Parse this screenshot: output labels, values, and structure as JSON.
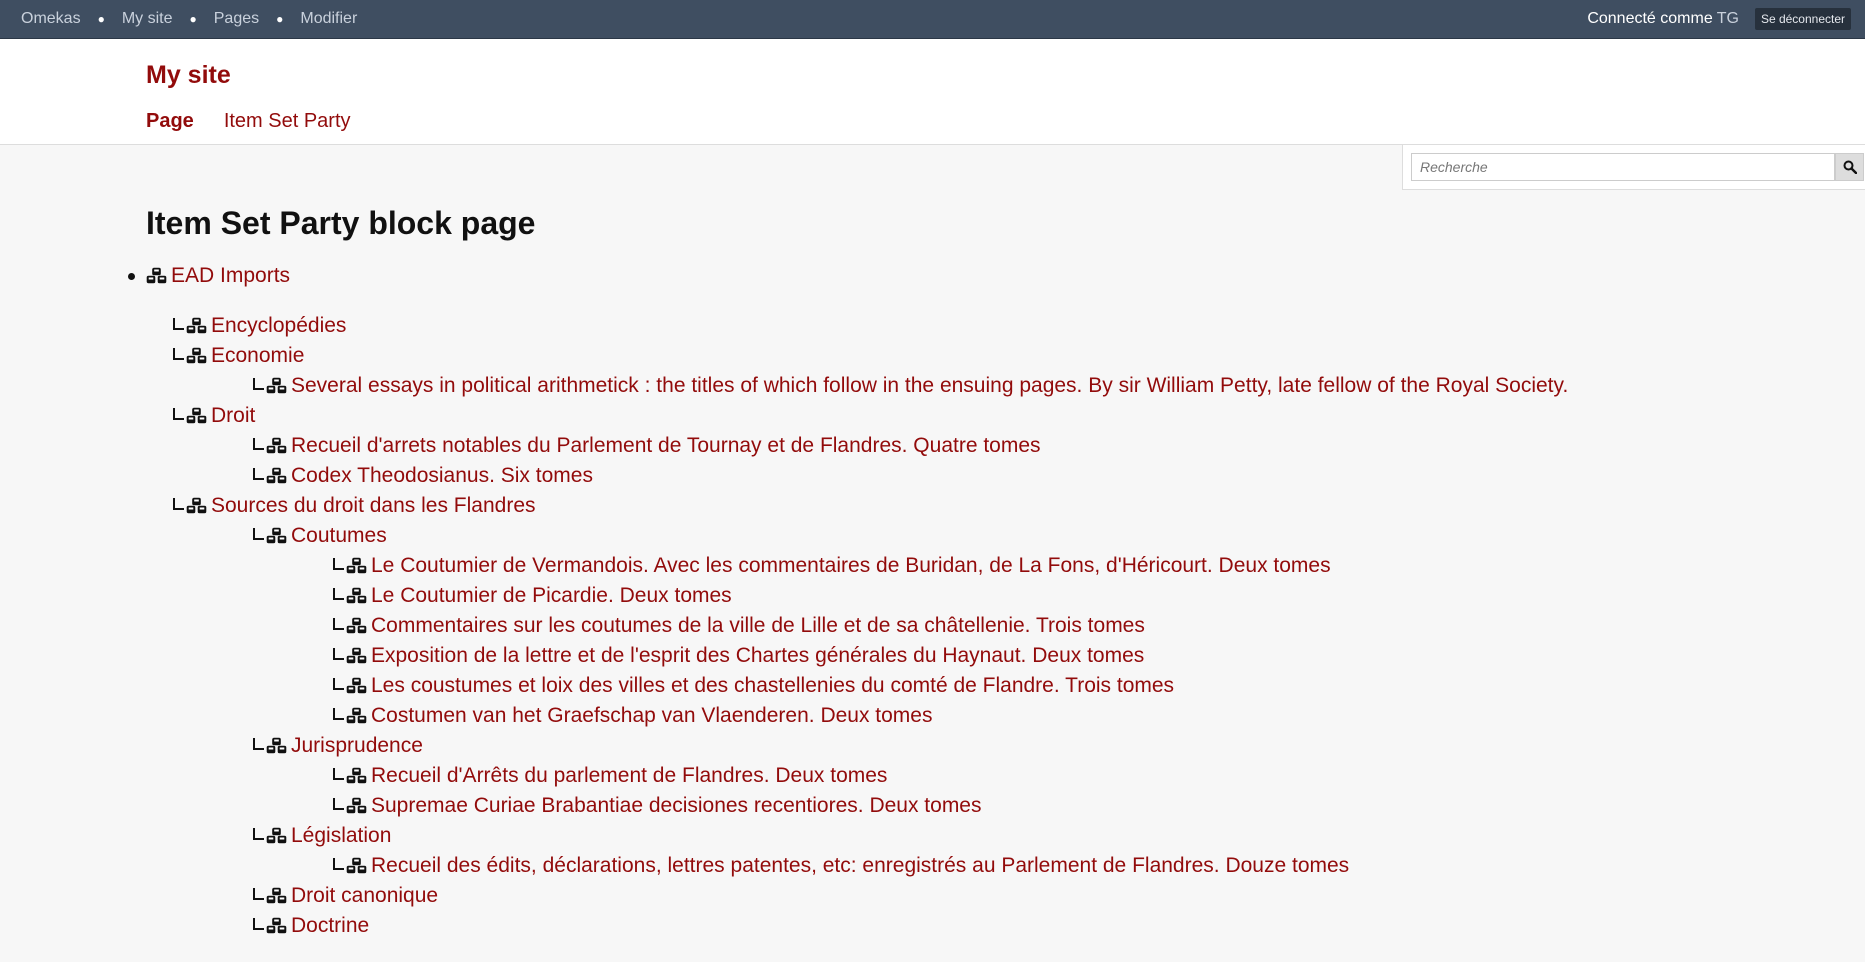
{
  "adminbar": {
    "crumbs": [
      "Omekas",
      "My site",
      "Pages",
      "Modifier"
    ],
    "logged_in_label": "Connecté comme",
    "user": "TG",
    "logout_label": "Se déconnecter"
  },
  "site": {
    "title": "My site",
    "nav": [
      "Page",
      "Item Set Party"
    ]
  },
  "search": {
    "placeholder": "Recherche"
  },
  "page_title": "Item Set Party block page",
  "tree": [
    {
      "label": "EAD Imports",
      "depth": 0
    },
    {
      "label": "Encyclopédies",
      "depth": 1
    },
    {
      "label": "Economie",
      "depth": 1
    },
    {
      "label": "Several essays in political arithmetick : the titles of which follow in the ensuing pages. By sir William Petty, late fellow of the Royal Society.",
      "depth": 2
    },
    {
      "label": "Droit",
      "depth": 1
    },
    {
      "label": "Recueil d'arrets notables du Parlement de Tournay et de Flandres. Quatre tomes",
      "depth": 2
    },
    {
      "label": "Codex Theodosianus. Six tomes",
      "depth": 2
    },
    {
      "label": "Sources du droit dans les Flandres",
      "depth": 1
    },
    {
      "label": "Coutumes",
      "depth": 2
    },
    {
      "label": "Le Coutumier de Vermandois. Avec les commentaires de Buridan, de La Fons, d'Héricourt. Deux tomes",
      "depth": 3
    },
    {
      "label": "Le Coutumier de Picardie. Deux tomes",
      "depth": 3
    },
    {
      "label": "Commentaires sur les coutumes de la ville de Lille et de sa châtellenie. Trois tomes",
      "depth": 3
    },
    {
      "label": "Exposition de la lettre et de l'esprit des Chartes générales du Haynaut. Deux tomes",
      "depth": 3
    },
    {
      "label": "Les coustumes et loix des villes et des chastellenies du comté de Flandre. Trois tomes",
      "depth": 3
    },
    {
      "label": "Costumen van het Graefschap van Vlaenderen. Deux tomes",
      "depth": 3
    },
    {
      "label": "Jurisprudence",
      "depth": 2
    },
    {
      "label": "Recueil d'Arrêts du parlement de Flandres. Deux tomes",
      "depth": 3
    },
    {
      "label": "Supremae Curiae Brabantiae decisiones recentiores. Deux tomes",
      "depth": 3
    },
    {
      "label": "Législation",
      "depth": 2
    },
    {
      "label": "Recueil des édits, déclarations, lettres patentes, etc: enregistrés au Parlement de Flandres. Douze tomes",
      "depth": 3
    },
    {
      "label": "Droit canonique",
      "depth": 2
    },
    {
      "label": "Doctrine",
      "depth": 2
    }
  ],
  "colors": {
    "accent": "#920b0b",
    "adminbar_bg": "#3f4e61",
    "page_bg": "#f7f7f7"
  },
  "icons": {
    "tree_item": "item-set-icon",
    "search": "search-icon"
  }
}
